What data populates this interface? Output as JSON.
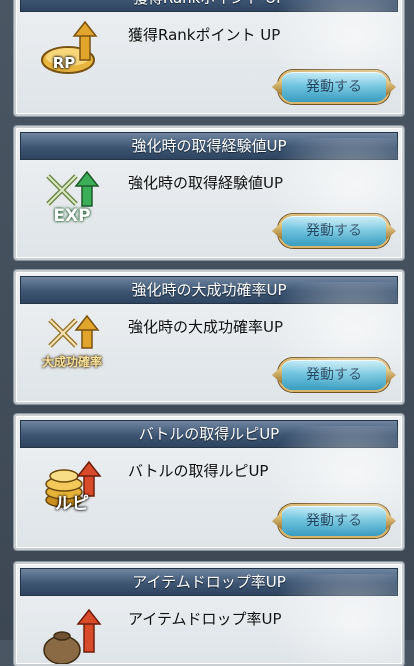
{
  "cards": [
    {
      "title": "獲得Rankポイント UP",
      "description": "獲得Rankポイント UP",
      "icon": "rp-arrow-icon",
      "icon_text": "RP",
      "button": "発動する"
    },
    {
      "title": "強化時の取得経験値UP",
      "description": "強化時の取得経験値UP",
      "icon": "exp-swords-icon",
      "icon_text": "EXP",
      "button": "発動する"
    },
    {
      "title": "強化時の大成功確率UP",
      "description": "強化時の大成功確率UP",
      "icon": "great-success-swords-icon",
      "icon_text": "大成功確率",
      "button": "発動する"
    },
    {
      "title": "バトルの取得ルピUP",
      "description": "バトルの取得ルピUP",
      "icon": "rupie-coins-icon",
      "icon_text": "ルピ",
      "button": "発動する"
    },
    {
      "title": "アイテムドロップ率UP",
      "description": "アイテムドロップ率UP",
      "icon": "item-bag-icon",
      "icon_text": "",
      "button": ""
    }
  ],
  "colors": {
    "header": "#3e5673",
    "button": "#6fc4de",
    "button_border": "#d8b56a",
    "up_arrow_gold": "#e0a52a",
    "up_arrow_green": "#3cae58",
    "up_arrow_red": "#d94a2a"
  }
}
